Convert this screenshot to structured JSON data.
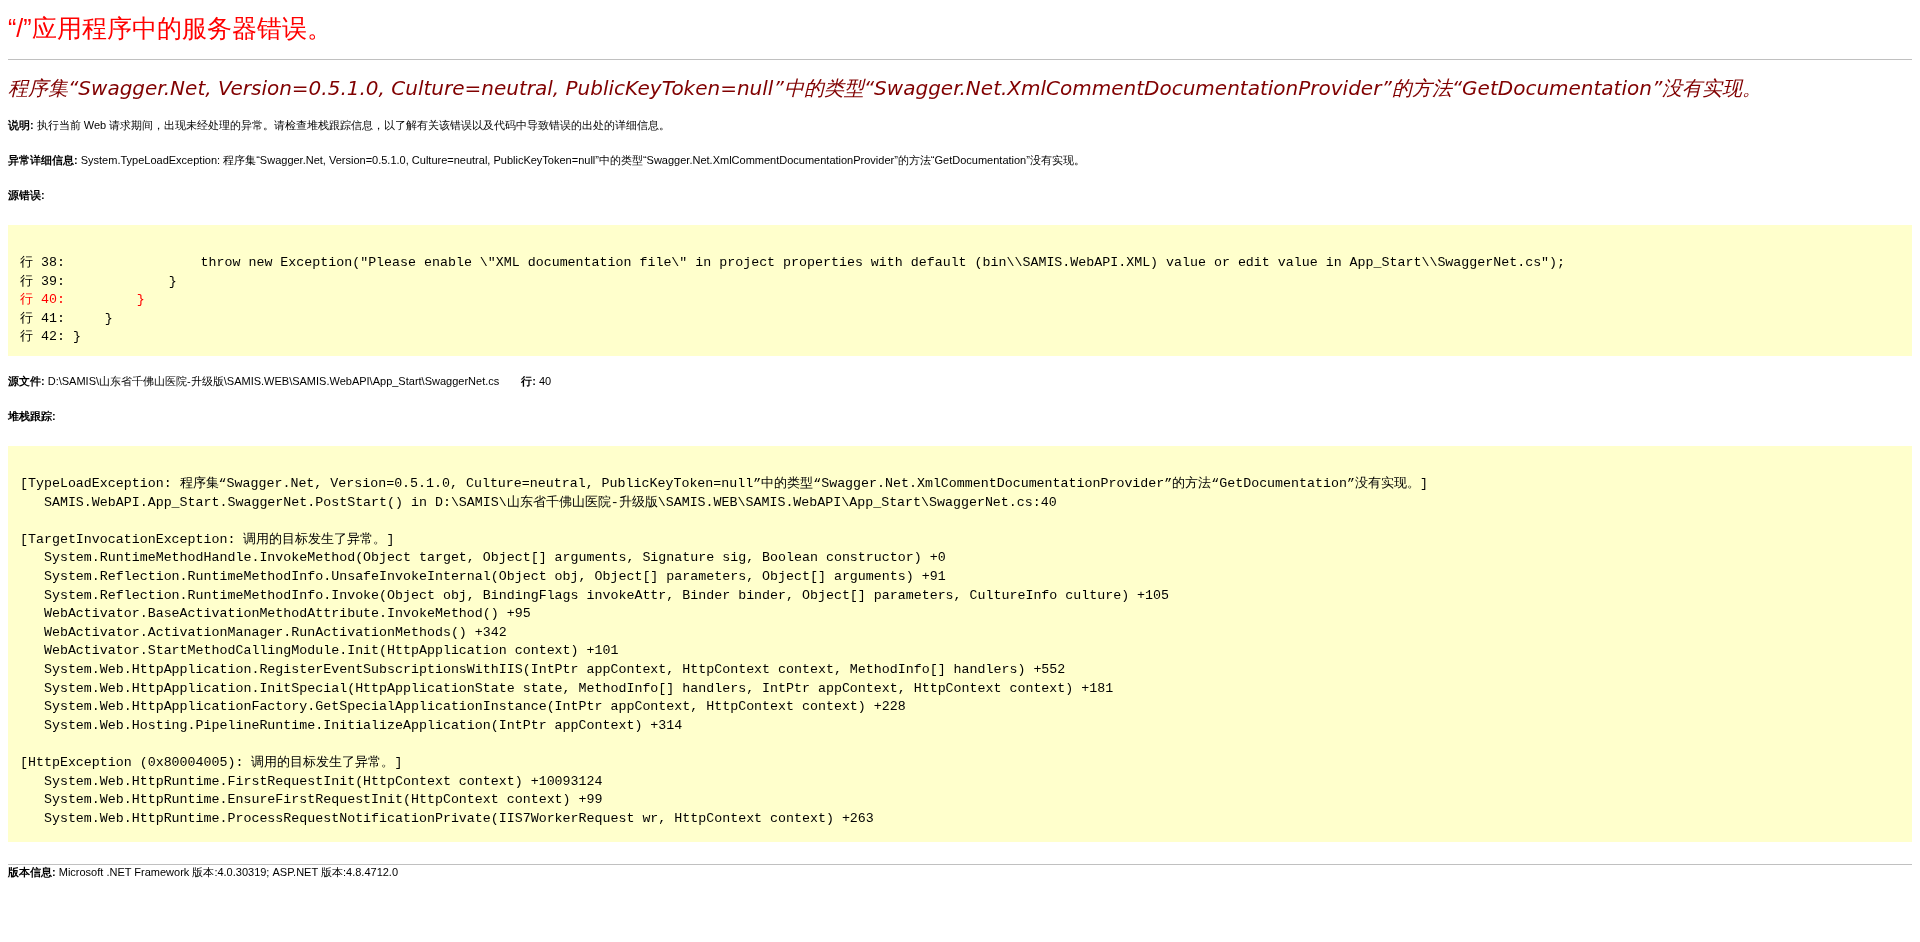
{
  "title": "“/”应用程序中的服务器错误。",
  "error_message": "程序集“Swagger.Net, Version=0.5.1.0, Culture=neutral, PublicKeyToken=null”中的类型“Swagger.Net.XmlCommentDocumentationProvider”的方法“GetDocumentation”没有实现。",
  "description": "**说明:** 执行当前 Web 请求期间，出现未经处理的异常。请检查堆栈跟踪信息，以了解有关该错误以及代码中导致错误的出处的详细信息。",
  "exception_details": "**异常详细信息:** System.TypeLoadException: 程序集“Swagger.Net, Version=0.5.1.0, Culture=neutral, PublicKeyToken=null”中的类型“Swagger.Net.XmlCommentDocumentationProvider”的方法“GetDocumentation”没有实现。",
  "source_error": {
    "heading": "源错误:",
    "lines": [
      {
        "text": "行 38:                 throw new Exception(\"Please enable \\\"XML documentation file\\\" in project properties with default (bin\\\\SAMIS.WebAPI.XML) value or edit value in App_Start\\\\SwaggerNet.cs\");",
        "highlighted": false
      },
      {
        "text": "行 39:             }",
        "highlighted": false
      },
      {
        "text": "行 40:         }",
        "highlighted": true
      },
      {
        "text": "行 41:     }",
        "highlighted": false
      },
      {
        "text": "行 42: }",
        "highlighted": false
      }
    ]
  },
  "source_file": "**源文件:** D:\\SAMIS\\山东省千佛山医院-升级版\\SAMIS.WEB\\SAMIS.WebAPI\\App_Start\\SwaggerNet.cs",
  "source_line": "**行:** 40",
  "stack_trace": {
    "heading": "堆栈跟踪:",
    "groups": [
      {
        "header": "[TypeLoadException: 程序集“Swagger.Net, Version=0.5.1.0, Culture=neutral, PublicKeyToken=null”中的类型“Swagger.Net.XmlCommentDocumentationProvider”的方法“GetDocumentation”没有实现。]",
        "frames": [
          "SAMIS.WebAPI.App_Start.SwaggerNet.PostStart() in D:\\SAMIS\\山东省千佛山医院-升级版\\SAMIS.WEB\\SAMIS.WebAPI\\App_Start\\SwaggerNet.cs:40"
        ]
      },
      {
        "header": "[TargetInvocationException: 调用的目标发生了异常。]",
        "frames": [
          "System.RuntimeMethodHandle.InvokeMethod(Object target, Object[] arguments, Signature sig, Boolean constructor) +0",
          "System.Reflection.RuntimeMethodInfo.UnsafeInvokeInternal(Object obj, Object[] parameters, Object[] arguments) +91",
          "System.Reflection.RuntimeMethodInfo.Invoke(Object obj, BindingFlags invokeAttr, Binder binder, Object[] parameters, CultureInfo culture) +105",
          "WebActivator.BaseActivationMethodAttribute.InvokeMethod() +95",
          "WebActivator.ActivationManager.RunActivationMethods() +342",
          "WebActivator.StartMethodCallingModule.Init(HttpApplication context) +101",
          "System.Web.HttpApplication.RegisterEventSubscriptionsWithIIS(IntPtr appContext, HttpContext context, MethodInfo[] handlers) +552",
          "System.Web.HttpApplication.InitSpecial(HttpApplicationState state, MethodInfo[] handlers, IntPtr appContext, HttpContext context) +181",
          "System.Web.HttpApplicationFactory.GetSpecialApplicationInstance(IntPtr appContext, HttpContext context) +228",
          "System.Web.Hosting.PipelineRuntime.InitializeApplication(IntPtr appContext) +314"
        ]
      },
      {
        "header": "[HttpException (0x80004005): 调用的目标发生了异常。]",
        "frames": [
          "System.Web.HttpRuntime.FirstRequestInit(HttpContext context) +10093124",
          "System.Web.HttpRuntime.EnsureFirstRequestInit(HttpContext context) +99",
          "System.Web.HttpRuntime.ProcessRequestNotificationPrivate(IIS7WorkerRequest wr, HttpContext context) +263"
        ]
      }
    ]
  },
  "version_info": "**版本信息:** Microsoft .NET Framework 版本:4.0.30319; ASP.NET 版本:4.8.4712.0"
}
